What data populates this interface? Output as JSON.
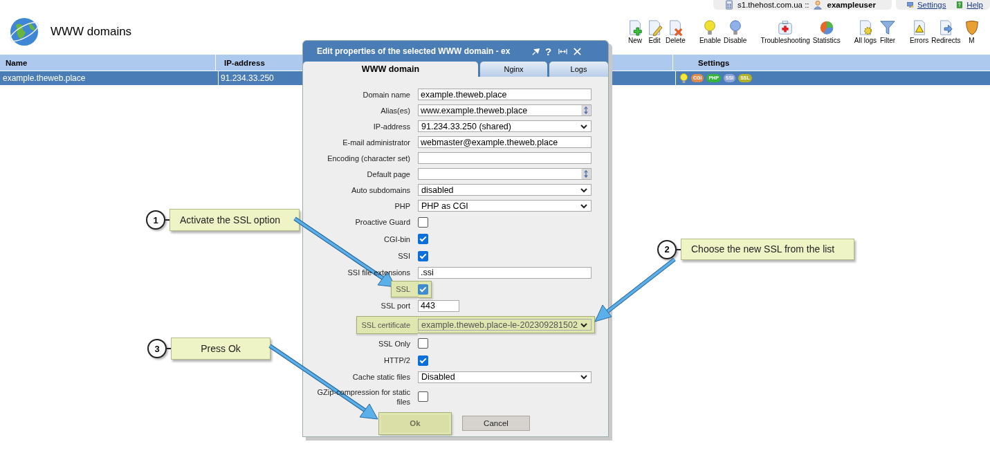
{
  "top_bar": {
    "server": "s1.thehost.com.ua ::",
    "user": "exampleuser",
    "links": [
      {
        "label": "Settings"
      },
      {
        "label": "Help"
      }
    ]
  },
  "page": {
    "title": "WWW domains"
  },
  "toolbar": [
    {
      "label": "New"
    },
    {
      "label": "Edit"
    },
    {
      "label": "Delete"
    },
    {
      "label": "Enable"
    },
    {
      "label": "Disable"
    },
    {
      "label": "Troubleshooting"
    },
    {
      "label": "Statistics"
    },
    {
      "label": "All logs"
    },
    {
      "label": "Filter"
    },
    {
      "label": "Errors"
    },
    {
      "label": "Redirects"
    },
    {
      "label": "M"
    }
  ],
  "table": {
    "columns": [
      "Name",
      "IP-address",
      "Settings"
    ],
    "rows": [
      {
        "selected": true,
        "name": "example.theweb.place",
        "ip": "91.234.33.250",
        "badges": [
          {
            "text": "CGI",
            "color": "#de8a4c"
          },
          {
            "text": "PHP",
            "color": "#35b33a"
          },
          {
            "text": "SSI",
            "color": "#8ea5d9"
          },
          {
            "text": "SSL",
            "color": "#b3b22a"
          }
        ]
      }
    ]
  },
  "dialog": {
    "title": "Edit properties of the selected WWW domain - ex",
    "help": "?",
    "tabs": [
      {
        "label": "WWW domain",
        "selected": true
      },
      {
        "label": "Nginx",
        "selected": false
      },
      {
        "label": "Logs",
        "selected": false
      }
    ],
    "fields": [
      {
        "kind": "text",
        "label": "Domain name",
        "value": "example.theweb.place",
        "highlighted": false
      },
      {
        "kind": "combo",
        "label": "Alias(es)",
        "value": "www.example.theweb.place",
        "highlighted": false
      },
      {
        "kind": "select",
        "label": "IP-address",
        "value": "91.234.33.250 (shared)",
        "highlighted": false
      },
      {
        "kind": "text",
        "label": "E-mail administrator",
        "value": "webmaster@example.theweb.place",
        "highlighted": false
      },
      {
        "kind": "text",
        "label": "Encoding (character set)",
        "highlighted": false
      },
      {
        "kind": "combo",
        "label": "Default page",
        "highlighted": false
      },
      {
        "kind": "select",
        "label": "Auto subdomains",
        "value": "disabled",
        "highlighted": false
      },
      {
        "kind": "select",
        "label": "PHP",
        "value": "PHP as CGI",
        "highlighted": false
      },
      {
        "kind": "checkbox",
        "label": "Proactive Guard",
        "checked": false,
        "highlighted": false
      },
      {
        "kind": "checkbox",
        "label": "CGI-bin",
        "checked": true,
        "highlighted": false
      },
      {
        "kind": "checkbox",
        "label": "SSI",
        "checked": true,
        "highlighted": false
      },
      {
        "kind": "text",
        "label": "SSI file extensions",
        "value": ".ssi",
        "highlighted": false
      },
      {
        "kind": "checkbox",
        "label": "SSL",
        "checked": true,
        "highlighted": true
      },
      {
        "kind": "short",
        "label": "SSL port",
        "value": "443",
        "highlighted": false
      },
      {
        "kind": "select",
        "label": "SSL certificate",
        "value": "example.theweb.place-le-202309281502",
        "highlighted": true
      },
      {
        "kind": "checkbox",
        "label": "SSL Only",
        "checked": false,
        "highlighted": false
      },
      {
        "kind": "checkbox",
        "label": "HTTP/2",
        "checked": true,
        "highlighted": false
      },
      {
        "kind": "select",
        "label": "Cache static files",
        "value": "Disabled",
        "highlighted": false
      },
      {
        "kind": "checkbox",
        "label": "GZip-compression for static files",
        "checked": false,
        "highlighted": false
      }
    ],
    "buttons": [
      {
        "label": "Ok",
        "highlighted": true
      },
      {
        "label": "Cancel",
        "highlighted": false
      }
    ]
  },
  "callouts": [
    {
      "number": "1",
      "text": "Activate the SSL option"
    },
    {
      "number": "2",
      "text": "Choose the new SSL from the list"
    },
    {
      "number": "3",
      "text": "Press Ok"
    }
  ]
}
